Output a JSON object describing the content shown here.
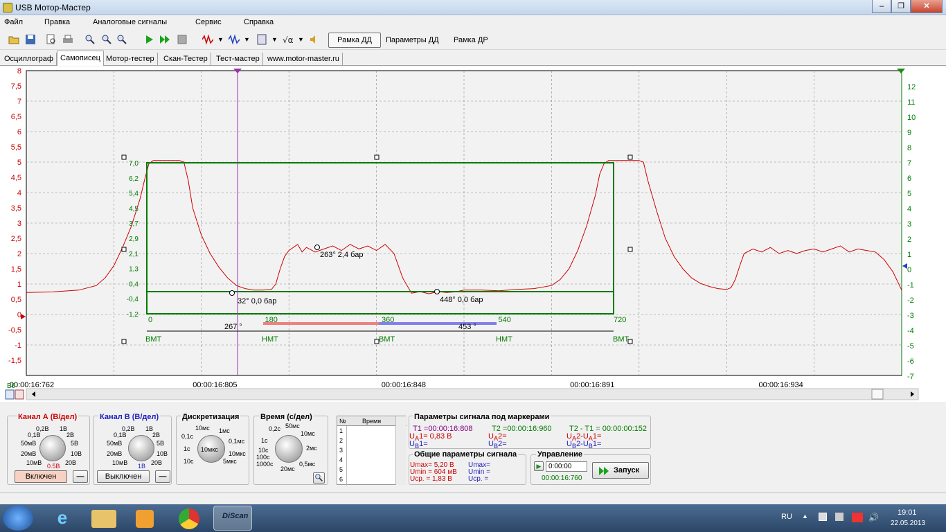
{
  "window": {
    "title": "USB Мотор-Мастер",
    "minimize": "–",
    "maximize": "❐",
    "close": "✕"
  },
  "menu": [
    "Файл",
    "Правка",
    "Аналоговые сигналы",
    "Сервис",
    "Справка"
  ],
  "toolbar": {
    "btn_rama_dd": "Рамка ДД",
    "btn_params_dd": "Параметры ДД",
    "btn_rama_dr": "Рамка ДР"
  },
  "tabs": [
    "Осциллограф",
    "Самописец",
    "Мотор-тестер",
    "Скан-Тестер",
    "Тест-мастер",
    "www.motor-master.ru"
  ],
  "plot": {
    "left_axis_labels": [
      "8",
      "7,5",
      "7",
      "6,5",
      "6",
      "5,5",
      "5",
      "4,5",
      "4",
      "3,5",
      "3",
      "2,5",
      "2",
      "1,5",
      "1",
      "0,5",
      "0",
      "-0,5",
      "-1",
      "-1,5"
    ],
    "right_axis_labels": [
      "12",
      "11",
      "10",
      "9",
      "8",
      "7",
      "6",
      "5",
      "4",
      "3",
      "2",
      "1",
      "0",
      "-1",
      "-2",
      "-3",
      "-4",
      "-5",
      "-6",
      "-7"
    ],
    "time_labels": [
      "00:00:16:762",
      "00:00:16:805",
      "00:00:16:848",
      "00:00:16:891",
      "00:00:16:934"
    ],
    "left_corner": "В0",
    "frame_pressure_labels": [
      "7,0",
      "6,2",
      "5,4",
      "4,5",
      "3,7",
      "2,9",
      "2,1",
      "1,3",
      "0,4",
      "-0,4",
      "-1,2"
    ],
    "frame_angle_labels": [
      "0",
      "180",
      "360",
      "540",
      "720"
    ],
    "points": [
      "32° 0,0 бар",
      "263° 2,4 бар",
      "448° 0,0 бар"
    ],
    "angles": [
      "267 °",
      "453 °"
    ],
    "tdc_labels": [
      "ВМТ",
      "НМТ",
      "ВМТ",
      "НМТ",
      "ВМТ"
    ],
    "colors": {
      "channel_a": "#cc0000",
      "channel_b": "#008000",
      "frame": "#007a00",
      "marker": "#9b30b0"
    },
    "signal_a": [
      [
        0,
        0.72
      ],
      [
        0.03,
        0.74
      ],
      [
        0.06,
        0.8
      ],
      [
        0.08,
        0.95
      ],
      [
        0.09,
        1.2
      ],
      [
        0.1,
        1.6
      ],
      [
        0.11,
        2.2
      ],
      [
        0.12,
        2.9
      ],
      [
        0.13,
        3.8
      ],
      [
        0.135,
        4.4
      ],
      [
        0.14,
        4.95
      ],
      [
        0.145,
        5.05
      ],
      [
        0.15,
        5.05
      ],
      [
        0.155,
        5.05
      ],
      [
        0.16,
        5.05
      ],
      [
        0.165,
        5.05
      ],
      [
        0.17,
        5.05
      ],
      [
        0.175,
        5.05
      ],
      [
        0.18,
        5.0
      ],
      [
        0.185,
        4.4
      ],
      [
        0.19,
        3.5
      ],
      [
        0.2,
        2.6
      ],
      [
        0.21,
        2.0
      ],
      [
        0.22,
        1.55
      ],
      [
        0.23,
        1.2
      ],
      [
        0.24,
        0.95
      ],
      [
        0.25,
        0.85
      ],
      [
        0.26,
        0.8
      ],
      [
        0.27,
        0.8
      ],
      [
        0.28,
        0.82
      ],
      [
        0.285,
        1.0
      ],
      [
        0.29,
        1.5
      ],
      [
        0.295,
        1.9
      ],
      [
        0.3,
        2.1
      ],
      [
        0.31,
        2.3
      ],
      [
        0.315,
        2.05
      ],
      [
        0.32,
        2.2
      ],
      [
        0.33,
        2.05
      ],
      [
        0.34,
        2.15
      ],
      [
        0.35,
        2.25
      ],
      [
        0.36,
        2.1
      ],
      [
        0.37,
        2.3
      ],
      [
        0.38,
        2.15
      ],
      [
        0.39,
        2.25
      ],
      [
        0.4,
        2.1
      ],
      [
        0.41,
        2.3
      ],
      [
        0.42,
        2.0
      ],
      [
        0.43,
        1.2
      ],
      [
        0.44,
        0.7
      ],
      [
        0.45,
        0.75
      ],
      [
        0.46,
        0.68
      ],
      [
        0.47,
        0.75
      ],
      [
        0.48,
        0.72
      ],
      [
        0.49,
        0.74
      ],
      [
        0.5,
        0.8
      ],
      [
        0.52,
        0.8
      ],
      [
        0.54,
        0.78
      ],
      [
        0.56,
        0.82
      ],
      [
        0.58,
        0.85
      ],
      [
        0.6,
        0.95
      ],
      [
        0.61,
        1.15
      ],
      [
        0.62,
        1.5
      ],
      [
        0.63,
        2.1
      ],
      [
        0.64,
        2.9
      ],
      [
        0.65,
        3.9
      ],
      [
        0.655,
        4.6
      ],
      [
        0.66,
        4.95
      ],
      [
        0.665,
        5.05
      ],
      [
        0.67,
        5.05
      ],
      [
        0.675,
        5.05
      ],
      [
        0.68,
        5.05
      ],
      [
        0.685,
        5.05
      ],
      [
        0.69,
        5.05
      ],
      [
        0.695,
        5.05
      ],
      [
        0.7,
        5.05
      ],
      [
        0.705,
        5.0
      ],
      [
        0.71,
        4.4
      ],
      [
        0.72,
        3.4
      ],
      [
        0.73,
        2.5
      ],
      [
        0.74,
        1.9
      ],
      [
        0.75,
        1.5
      ],
      [
        0.76,
        1.2
      ],
      [
        0.77,
        1.02
      ],
      [
        0.78,
        0.92
      ],
      [
        0.79,
        0.85
      ],
      [
        0.8,
        0.82
      ],
      [
        0.805,
        0.88
      ],
      [
        0.81,
        1.15
      ],
      [
        0.815,
        1.6
      ],
      [
        0.82,
        2.0
      ],
      [
        0.83,
        2.15
      ],
      [
        0.84,
        2.05
      ],
      [
        0.85,
        2.2
      ],
      [
        0.86,
        2.0
      ],
      [
        0.87,
        2.1
      ],
      [
        0.88,
        2.0
      ],
      [
        0.89,
        2.1
      ],
      [
        0.9,
        2.15
      ],
      [
        0.91,
        2.05
      ],
      [
        0.92,
        2.15
      ],
      [
        0.93,
        2.25
      ],
      [
        0.94,
        2.05
      ],
      [
        0.95,
        2.15
      ],
      [
        0.96,
        2.1
      ],
      [
        0.97,
        2.05
      ],
      [
        0.98,
        1.8
      ],
      [
        0.99,
        1.4
      ],
      [
        1.0,
        0.8
      ]
    ]
  },
  "panel": {
    "chan_a": {
      "title": "Канал А (В/дел)",
      "scale_labels": [
        "0,2В",
        "1В",
        "0,1В",
        "2В",
        "50мВ",
        "5В",
        "20мВ",
        "10В",
        "10мВ",
        "20В"
      ],
      "value": "0.5В",
      "button": "Включен",
      "minus": "—"
    },
    "chan_b": {
      "title": "Канал В (В/дел)",
      "scale_labels": [
        "0,2В",
        "1В",
        "0,1В",
        "2В",
        "50мВ",
        "5В",
        "20мВ",
        "10В",
        "10мВ",
        "20В"
      ],
      "value": "1В",
      "button": "Выключен",
      "minus": "—"
    },
    "discr": {
      "title": "Дискретизация",
      "scale_labels": [
        "10мс",
        "1мс",
        "0,1с",
        "0,1мс",
        "1с",
        "10мкс",
        "10с",
        "5мкс"
      ],
      "value": "10мкс"
    },
    "time": {
      "title": "Время (с/дел)",
      "scale_labels": [
        "0,2с",
        "50мс",
        "1с",
        "10мс",
        "10с",
        "2мс",
        "100с",
        "1000с",
        "0,5мс",
        "20мс"
      ]
    },
    "table": {
      "col_no": "№",
      "col_time": "Время",
      "rows": [
        "1",
        "2",
        "3",
        "4",
        "5",
        "6"
      ]
    },
    "markers": {
      "title": "Параметры сигнала под маркерами",
      "t1": "T1 =00:00:16:808",
      "t2": "T2 =00:00:16:960",
      "dt": "T2 - T1 = 00:00:00:152",
      "ua1": "= 0,83 В",
      "ub1": "=",
      "ua2": "=",
      "ub2": "=",
      "dua": "=",
      "dub": "="
    },
    "general": {
      "title": "Общие параметры сигнала",
      "umax_a": "Umax= 5,20 В",
      "umin_a": "Umin = 604 мВ",
      "ucp_a": "Ucp. =  1,83 В",
      "umax_b": "Umax=",
      "umin_b": "Umin =",
      "ucp_b": "Ucp. ="
    },
    "control": {
      "title": "Управление",
      "spin_value": "0:00:00",
      "time": "00:00:16:760",
      "start": "Запуск"
    }
  },
  "taskbar": {
    "lang": "RU",
    "time": "19:01",
    "date": "22.05.2013",
    "app_label": "DiScan"
  }
}
